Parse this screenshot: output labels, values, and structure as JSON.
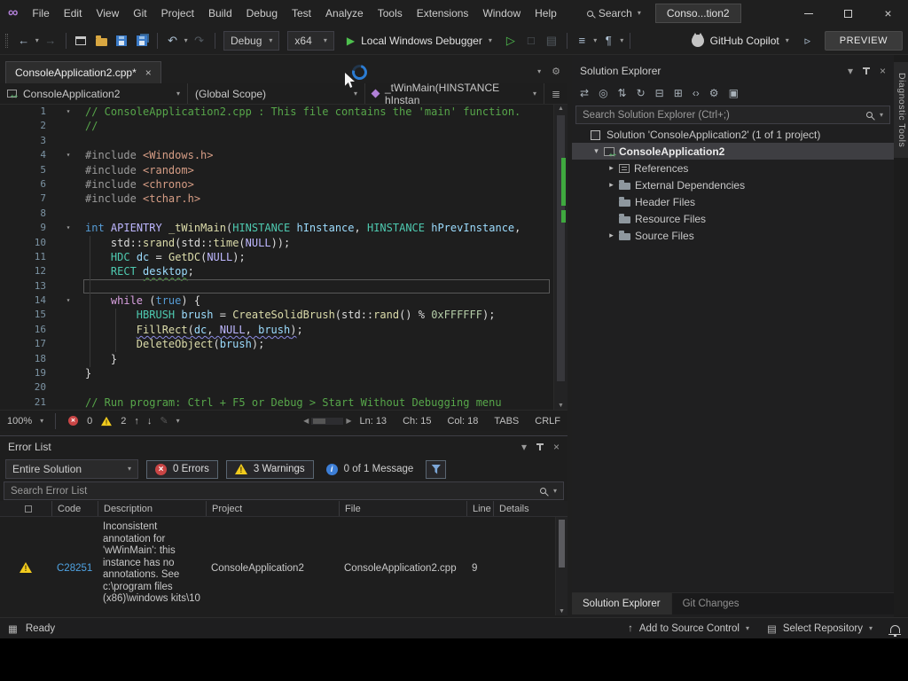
{
  "titlebar": {
    "menus": [
      "File",
      "Edit",
      "View",
      "Git",
      "Project",
      "Build",
      "Debug",
      "Test",
      "Analyze",
      "Tools",
      "Extensions",
      "Window",
      "Help"
    ],
    "search_label": "Search",
    "solution_badge": "Conso...tion2"
  },
  "toolbar": {
    "configuration": "Debug",
    "platform": "x64",
    "run_label": "Local Windows Debugger",
    "copilot_label": "GitHub Copilot",
    "preview_label": "PREVIEW"
  },
  "editor": {
    "tab_title": "ConsoleApplication2.cpp*",
    "navbar": {
      "project": "ConsoleApplication2",
      "scope": "(Global Scope)",
      "member": "_tWinMain(HINSTANCE hInstan"
    },
    "code_lines": [
      {
        "n": 1,
        "fold": true,
        "tokens": [
          [
            "// ConsoleApplication2.cpp : This file contains the 'main' function.",
            "com"
          ]
        ]
      },
      {
        "n": 2,
        "tokens": [
          [
            "//",
            "com"
          ]
        ]
      },
      {
        "n": 3,
        "tokens": []
      },
      {
        "n": 4,
        "fold": true,
        "tokens": [
          [
            "#include ",
            "pre"
          ],
          [
            "<Windows.h>",
            "str"
          ]
        ]
      },
      {
        "n": 5,
        "tokens": [
          [
            "#include ",
            "pre"
          ],
          [
            "<random>",
            "str"
          ]
        ]
      },
      {
        "n": 6,
        "tokens": [
          [
            "#include ",
            "pre"
          ],
          [
            "<chrono>",
            "str"
          ]
        ]
      },
      {
        "n": 7,
        "tokens": [
          [
            "#include ",
            "pre"
          ],
          [
            "<tchar.h>",
            "str"
          ]
        ]
      },
      {
        "n": 8,
        "tokens": []
      },
      {
        "n": 9,
        "fold": true,
        "tokens": [
          [
            "int",
            "kw"
          ],
          [
            " ",
            "pl"
          ],
          [
            "APIENTRY",
            "mac"
          ],
          [
            " ",
            "pl"
          ],
          [
            "_tWinMain",
            "fn"
          ],
          [
            "(",
            "pl"
          ],
          [
            "HINSTANCE",
            "typ"
          ],
          [
            " ",
            "pl"
          ],
          [
            "hInstance",
            "var"
          ],
          [
            ", ",
            "pl"
          ],
          [
            "HINSTANCE",
            "typ"
          ],
          [
            " ",
            "pl"
          ],
          [
            "hPrevInstance",
            "var"
          ],
          [
            ",",
            "pl"
          ]
        ]
      },
      {
        "n": 10,
        "tokens": [
          [
            "    std::",
            "pl"
          ],
          [
            "srand",
            "fn"
          ],
          [
            "(",
            "pl"
          ],
          [
            "std::",
            "pl"
          ],
          [
            "time",
            "fn"
          ],
          [
            "(",
            "pl"
          ],
          [
            "NULL",
            "mac"
          ],
          [
            "));",
            "pl"
          ]
        ]
      },
      {
        "n": 11,
        "tokens": [
          [
            "    ",
            "pl"
          ],
          [
            "HDC",
            "typ"
          ],
          [
            " ",
            "pl"
          ],
          [
            "dc",
            "var"
          ],
          [
            " = ",
            "pl"
          ],
          [
            "GetDC",
            "fn"
          ],
          [
            "(",
            "pl"
          ],
          [
            "NULL",
            "mac"
          ],
          [
            ");",
            "pl"
          ]
        ]
      },
      {
        "n": 12,
        "tokens": [
          [
            "    ",
            "pl"
          ],
          [
            "RECT",
            "typ"
          ],
          [
            " ",
            "pl"
          ],
          [
            "desktop",
            "var sqg"
          ],
          [
            ";",
            "pl"
          ]
        ]
      },
      {
        "n": 13,
        "current": true,
        "tokens": []
      },
      {
        "n": 14,
        "fold": true,
        "tokens": [
          [
            "    ",
            "pl"
          ],
          [
            "while",
            "ctl"
          ],
          [
            " (",
            "pl"
          ],
          [
            "true",
            "kw"
          ],
          [
            ") {",
            "pl"
          ]
        ]
      },
      {
        "n": 15,
        "tokens": [
          [
            "        ",
            "pl"
          ],
          [
            "HBRUSH",
            "typ"
          ],
          [
            " ",
            "pl"
          ],
          [
            "brush",
            "var"
          ],
          [
            " = ",
            "pl"
          ],
          [
            "CreateSolidBrush",
            "fn"
          ],
          [
            "(",
            "pl"
          ],
          [
            "std::",
            "pl"
          ],
          [
            "rand",
            "fn"
          ],
          [
            "() % ",
            "pl"
          ],
          [
            "0xFFFFFF",
            "num"
          ],
          [
            ");",
            "pl"
          ]
        ]
      },
      {
        "n": 16,
        "tokens": [
          [
            "        ",
            "pl"
          ],
          [
            "FillRect",
            "fn sq"
          ],
          [
            "(",
            "pl sq"
          ],
          [
            "dc",
            "var sq"
          ],
          [
            ", ",
            "pl sq"
          ],
          [
            "NULL",
            "mac sq"
          ],
          [
            ", ",
            "pl sq"
          ],
          [
            "brush",
            "var sq"
          ],
          [
            ")",
            "pl sq"
          ],
          [
            ";",
            "pl"
          ]
        ]
      },
      {
        "n": 17,
        "tokens": [
          [
            "        ",
            "pl"
          ],
          [
            "DeleteObject",
            "fn"
          ],
          [
            "(",
            "pl"
          ],
          [
            "brush",
            "var"
          ],
          [
            ");",
            "pl"
          ]
        ]
      },
      {
        "n": 18,
        "tokens": [
          [
            "    }",
            "pl"
          ]
        ]
      },
      {
        "n": 19,
        "tokens": [
          [
            "}",
            "pl"
          ]
        ]
      },
      {
        "n": 20,
        "tokens": []
      },
      {
        "n": 21,
        "tokens": [
          [
            "// Run program: Ctrl + F5 or Debug > Start Without Debugging menu",
            "com"
          ]
        ]
      }
    ],
    "status": {
      "zoom": "100%",
      "errors": "0",
      "warnings": "2",
      "line": "Ln: 13",
      "char": "Ch: 15",
      "column": "Col: 18",
      "tabs": "TABS",
      "eol": "CRLF"
    }
  },
  "solution_explorer": {
    "title": "Solution Explorer",
    "search_placeholder": "Search Solution Explorer (Ctrl+;)",
    "toolbar_icons": [
      {
        "name": "sync-with-active-document-icon",
        "glyph": "⇄"
      },
      {
        "name": "pending-changes-filter-icon",
        "glyph": "◎"
      },
      {
        "name": "switch-views-icon",
        "glyph": "⇅"
      },
      {
        "name": "refresh-icon",
        "glyph": "↻"
      },
      {
        "name": "collapse-all-icon",
        "glyph": "⊟"
      },
      {
        "name": "show-all-files-icon",
        "glyph": "⊞"
      },
      {
        "name": "view-code-icon",
        "glyph": "‹›"
      },
      {
        "name": "properties-icon",
        "glyph": "⚙"
      },
      {
        "name": "preview-selected-items-icon",
        "glyph": "▣"
      }
    ],
    "tree": [
      {
        "label": "Solution 'ConsoleApplication2' (1 of 1 project)",
        "indent": 0,
        "arrow": "none",
        "icon": "solution-icon"
      },
      {
        "label": "ConsoleApplication2",
        "indent": 1,
        "arrow": "expanded",
        "icon": "cpp-project-icon",
        "selected": true,
        "bold": true
      },
      {
        "label": "References",
        "indent": 2,
        "arrow": "collapsed",
        "icon": "references-icon"
      },
      {
        "label": "External Dependencies",
        "indent": 2,
        "arrow": "collapsed",
        "icon": "dependencies-folder-icon"
      },
      {
        "label": "Header Files",
        "indent": 2,
        "arrow": "none",
        "icon": "folder-icon"
      },
      {
        "label": "Resource Files",
        "indent": 2,
        "arrow": "none",
        "icon": "folder-icon"
      },
      {
        "label": "Source Files",
        "indent": 2,
        "arrow": "collapsed",
        "icon": "folder-icon"
      }
    ],
    "bottom_tabs": [
      {
        "label": "Solution Explorer",
        "active": true
      },
      {
        "label": "Git Changes",
        "active": false
      }
    ]
  },
  "diagnostic_tools_tab": "Diagnostic Tools",
  "error_list": {
    "title": "Error List",
    "scope": "Entire Solution",
    "errors_label": "0 Errors",
    "warnings_label": "3 Warnings",
    "messages_label": "0 of 1 Message",
    "search_placeholder": "Search Error List",
    "columns": [
      "Code",
      "Description",
      "Project",
      "File",
      "Line",
      "Details"
    ],
    "rows": [
      {
        "severity": "warning",
        "code": "C28251",
        "description": "Inconsistent annotation for 'wWinMain': this instance has no annotations. See c:\\program files (x86)\\windows kits\\10",
        "project": "ConsoleApplication2",
        "file": "ConsoleApplication2.cpp",
        "line": "9",
        "details": ""
      }
    ]
  },
  "statusbar": {
    "ready": "Ready",
    "add_to_source_control": "Add to Source Control",
    "select_repository": "Select Repository"
  },
  "glyphs": {
    "infinity_logo": "∞",
    "chevron_down": "▾",
    "collapsed_arrow": "▸",
    "back_arrow": "←",
    "forward_arrow": "→",
    "undo_arrow": "↶",
    "redo_arrow": "↷",
    "play_solid": "▶",
    "play_outline": "▷",
    "up_arrow": "↑",
    "down_arrow": "↓",
    "scroll_left": "◀",
    "scroll_right": "▶",
    "scroll_up": "▲",
    "scroll_down": "▼",
    "close": "×",
    "gear": "⚙",
    "repo_box": "▤",
    "status_box": "▦",
    "ghost_square": "□",
    "ghost_list": "▤",
    "ghost_para": "¶",
    "ghost_lines": "≡",
    "send_triangle": "▹",
    "pencil": "✎",
    "nav_lines": "≣"
  }
}
